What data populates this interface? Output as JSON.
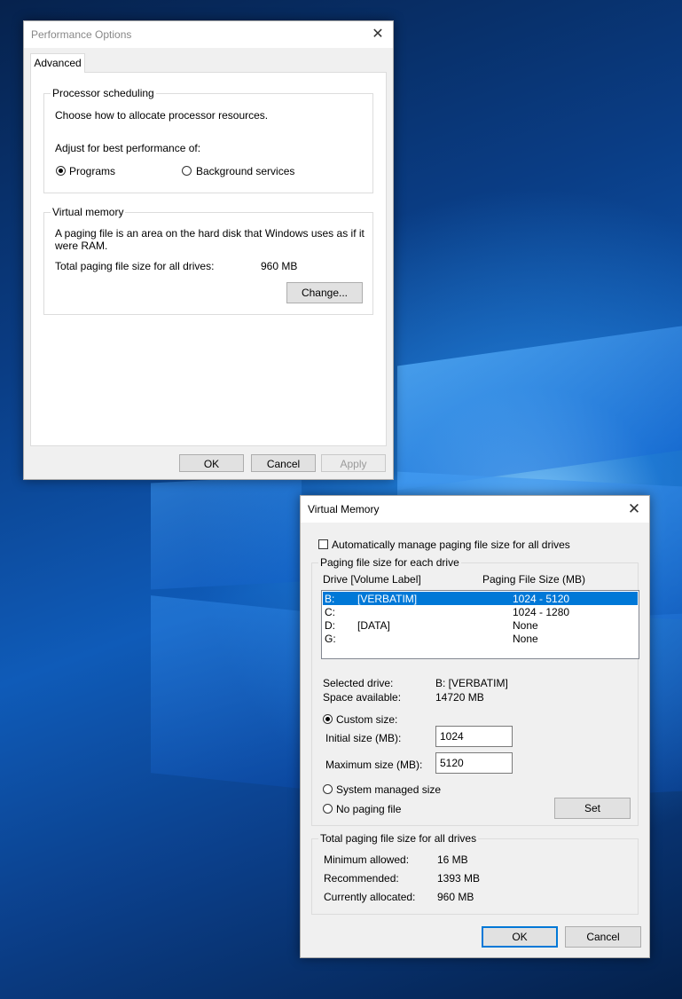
{
  "perf_options": {
    "title": "Performance Options",
    "tab": "Advanced",
    "processor": {
      "group_label": "Processor scheduling",
      "description": "Choose how to allocate processor resources.",
      "adjust_label": "Adjust for best performance of:",
      "option_programs": "Programs",
      "option_background": "Background services",
      "selected": "Programs"
    },
    "virtual_memory": {
      "group_label": "Virtual memory",
      "description_line1": "A paging file is an area on the hard disk that Windows uses as if it",
      "description_line2": "were RAM.",
      "total_label": "Total paging file size for all drives:",
      "total_value": "960 MB",
      "change_button": "Change..."
    },
    "buttons": {
      "ok": "OK",
      "cancel": "Cancel",
      "apply": "Apply"
    }
  },
  "virtual_mem_dialog": {
    "title": "Virtual Memory",
    "auto_manage_label": "Automatically manage paging file size for all drives",
    "auto_manage_checked": false,
    "each_drive_group": "Paging file size for each drive",
    "columns": {
      "drive": "Drive  [Volume Label]",
      "size": "Paging File Size (MB)"
    },
    "drives": [
      {
        "drive": "B:",
        "label": "[VERBATIM]",
        "size": "1024 - 5120",
        "selected": true
      },
      {
        "drive": "C:",
        "label": "",
        "size": "1024 - 1280",
        "selected": false
      },
      {
        "drive": "D:",
        "label": "[DATA]",
        "size": "None",
        "selected": false
      },
      {
        "drive": "G:",
        "label": "",
        "size": "None",
        "selected": false
      }
    ],
    "selected_drive_label": "Selected drive:",
    "selected_drive_value": "B:  [VERBATIM]",
    "space_available_label": "Space available:",
    "space_available_value": "14720 MB",
    "custom_size_label": "Custom size:",
    "initial_size_label": "Initial size (MB):",
    "initial_size_value": "1024",
    "maximum_size_label": "Maximum size (MB):",
    "maximum_size_value": "5120",
    "system_managed_label": "System managed size",
    "no_paging_label": "No paging file",
    "selected_option": "Custom size",
    "set_button": "Set",
    "totals_group": "Total paging file size for all drives",
    "min_allowed_label": "Minimum allowed:",
    "min_allowed_value": "16 MB",
    "recommended_label": "Recommended:",
    "recommended_value": "1393 MB",
    "currently_allocated_label": "Currently allocated:",
    "currently_allocated_value": "960 MB",
    "ok_button": "OK",
    "cancel_button": "Cancel"
  },
  "colors": {
    "accent": "#0078d7",
    "selection": "#0078d7",
    "dialog_bg": "#f0f0f0"
  }
}
